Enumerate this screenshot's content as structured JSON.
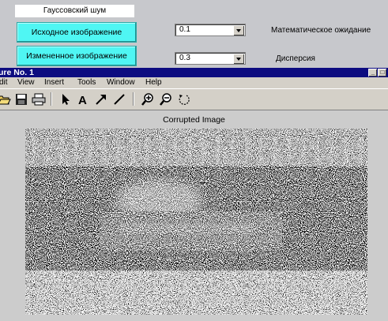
{
  "panel": {
    "title": "Гауссовский шум",
    "buttons": {
      "original": "Исходное изображение",
      "modified": "Измененное изображение"
    },
    "mean": {
      "value": "0.1",
      "label": "Математическое ожидание"
    },
    "variance": {
      "value": "0.3",
      "label": "Дисперсия"
    }
  },
  "figure_window": {
    "title": "ure No. 1",
    "menu": [
      "dit",
      "View",
      "Insert",
      "Tools",
      "Window",
      "Help"
    ],
    "toolbar": [
      "open-folder-icon",
      "save-icon",
      "print-icon",
      "select-arrow-icon",
      "text-icon",
      "arrow-icon",
      "line-icon",
      "zoom-in-icon",
      "zoom-out-icon",
      "rotate-icon"
    ],
    "axes_title": "Corrupted Image"
  }
}
